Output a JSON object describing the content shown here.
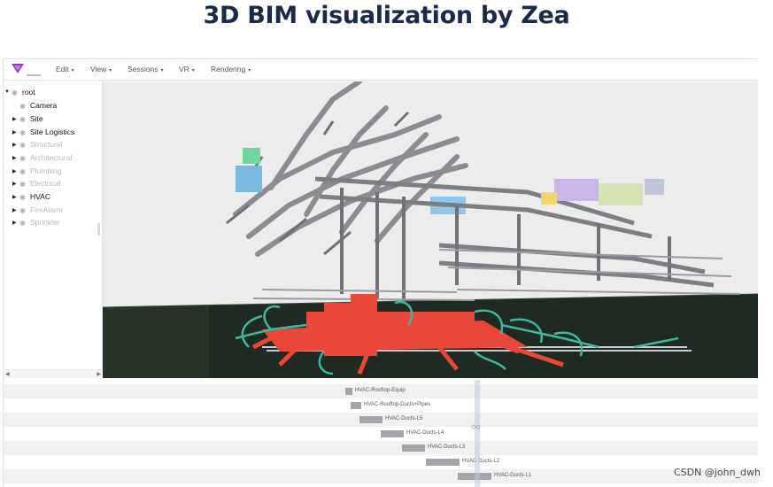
{
  "page": {
    "title": "3D BIM visualization by Zea"
  },
  "app": {
    "logo_icon": "zea-triangle-logo",
    "menu": [
      {
        "label": "Edit"
      },
      {
        "label": "View"
      },
      {
        "label": "Sessions"
      },
      {
        "label": "VR"
      },
      {
        "label": "Rendering"
      }
    ],
    "caret": "▾",
    "tree": {
      "root": {
        "label": "root",
        "expanded": true
      },
      "items": [
        {
          "label": "Camera",
          "expandable": false,
          "visible": true
        },
        {
          "label": "Site",
          "expandable": true,
          "visible": true
        },
        {
          "label": "Site Logistics",
          "expandable": true,
          "visible": true
        },
        {
          "label": "Structural",
          "expandable": true,
          "visible": false
        },
        {
          "label": "Architectural",
          "expandable": true,
          "visible": false
        },
        {
          "label": "Plumbing",
          "expandable": true,
          "visible": false
        },
        {
          "label": "Electrical",
          "expandable": true,
          "visible": false
        },
        {
          "label": "HVAC",
          "expandable": true,
          "visible": true
        },
        {
          "label": "FireAlarm",
          "expandable": true,
          "visible": false
        },
        {
          "label": "Sprinkler",
          "expandable": true,
          "visible": false
        }
      ]
    },
    "timeline": {
      "tracks": [
        {
          "label": "HVAC-Rooftop-Equip"
        },
        {
          "label": "HVAC-Rooftop-Ducts+Pipes"
        },
        {
          "label": "HVAC-Ducts-L5"
        },
        {
          "label": "HVAC-Ducts-L4"
        },
        {
          "label": "HVAC-Ducts-L3"
        },
        {
          "label": "HVAC-Ducts-L2"
        },
        {
          "label": "HVAC-Ducts-L1"
        }
      ]
    },
    "colors": {
      "ducts_gray": "#8a8c92",
      "hvac_red": "#e9473a",
      "pipes_teal": "#3fb8a0",
      "equip_blue": "#7ab8e0",
      "equip_green": "#6fd6a0",
      "ground": "#1f2a22"
    }
  },
  "watermark": "CSDN @john_dwh"
}
